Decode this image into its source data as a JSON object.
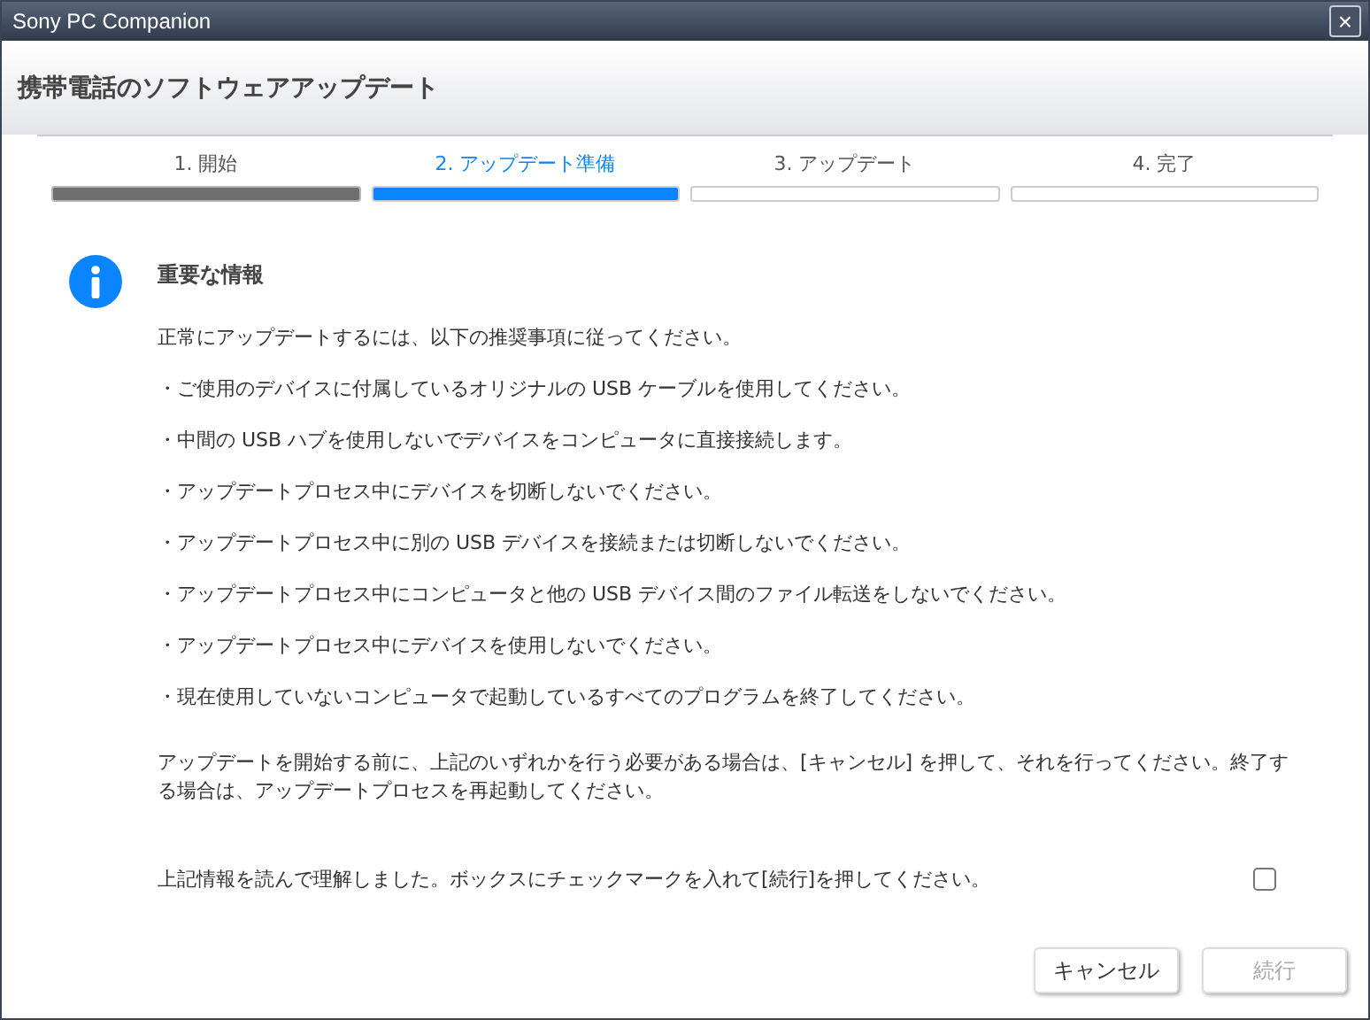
{
  "window": {
    "title": "Sony PC Companion",
    "close": "×"
  },
  "header": {
    "title": "携帯電話のソフトウェアアップデート"
  },
  "steps": [
    {
      "label": "1. 開始",
      "completed": true,
      "selected": false
    },
    {
      "label": "2. アップデート準備",
      "completed": false,
      "selected": true
    },
    {
      "label": "3. アップデート",
      "completed": false,
      "selected": false
    },
    {
      "label": "4. 完了",
      "completed": false,
      "selected": false
    }
  ],
  "info": {
    "title": "重要な情報",
    "intro": "正常にアップデートするには、以下の推奨事項に従ってください。",
    "bullets": [
      "・ご使用のデバイスに付属しているオリジナルの USB ケーブルを使用してください。",
      "・中間の USB ハブを使用しないでデバイスをコンピュータに直接接続します。",
      "・アップデートプロセス中にデバイスを切断しないでください。",
      "・アップデートプロセス中に別の USB デバイスを接続または切断しないでください。",
      "・アップデートプロセス中にコンピュータと他の USB デバイス間のファイル転送をしないでください。",
      "・アップデートプロセス中にデバイスを使用しないでください。",
      "・現在使用していないコンピュータで起動しているすべてのプログラムを終了してください。"
    ],
    "note": "アップデートを開始する前に、上記のいずれかを行う必要がある場合は、[キャンセル] を押して、それを行ってください。終了する場合は、アップデートプロセスを再起動してください。"
  },
  "agreement": {
    "label": "上記情報を読んで理解しました。ボックスにチェックマークを入れて[続行]を押してください。",
    "checked": false
  },
  "buttons": [
    {
      "label": "キャンセル",
      "disabled": false
    },
    {
      "label": "続行",
      "disabled": true
    }
  ]
}
